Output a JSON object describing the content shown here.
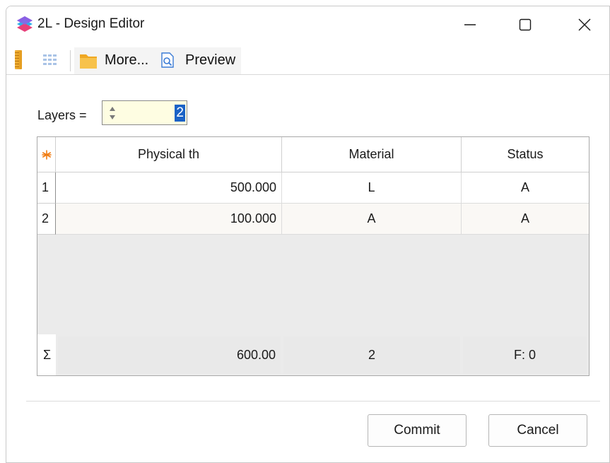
{
  "window": {
    "title": "2L - Design Editor"
  },
  "toolbar": {
    "more_label": "More...",
    "preview_label": "Preview"
  },
  "layers": {
    "label": "Layers =",
    "value": "2"
  },
  "table": {
    "corner_icon": "asterisk-icon",
    "columns": [
      "Physical th",
      "Material",
      "Status"
    ],
    "rows": [
      {
        "index": "1",
        "physical": "500.000",
        "material": "L",
        "status": "A"
      },
      {
        "index": "2",
        "physical": "100.000",
        "material": "A",
        "status": "A"
      }
    ],
    "summary": {
      "symbol": "Σ",
      "physical": "600.00",
      "material": "2",
      "status": "F: 0"
    }
  },
  "buttons": {
    "commit": "Commit",
    "cancel": "Cancel"
  },
  "colors": {
    "spinner_bg": "#fefde2",
    "selection": "#1a62c6",
    "corner_star": "#f07c12"
  }
}
